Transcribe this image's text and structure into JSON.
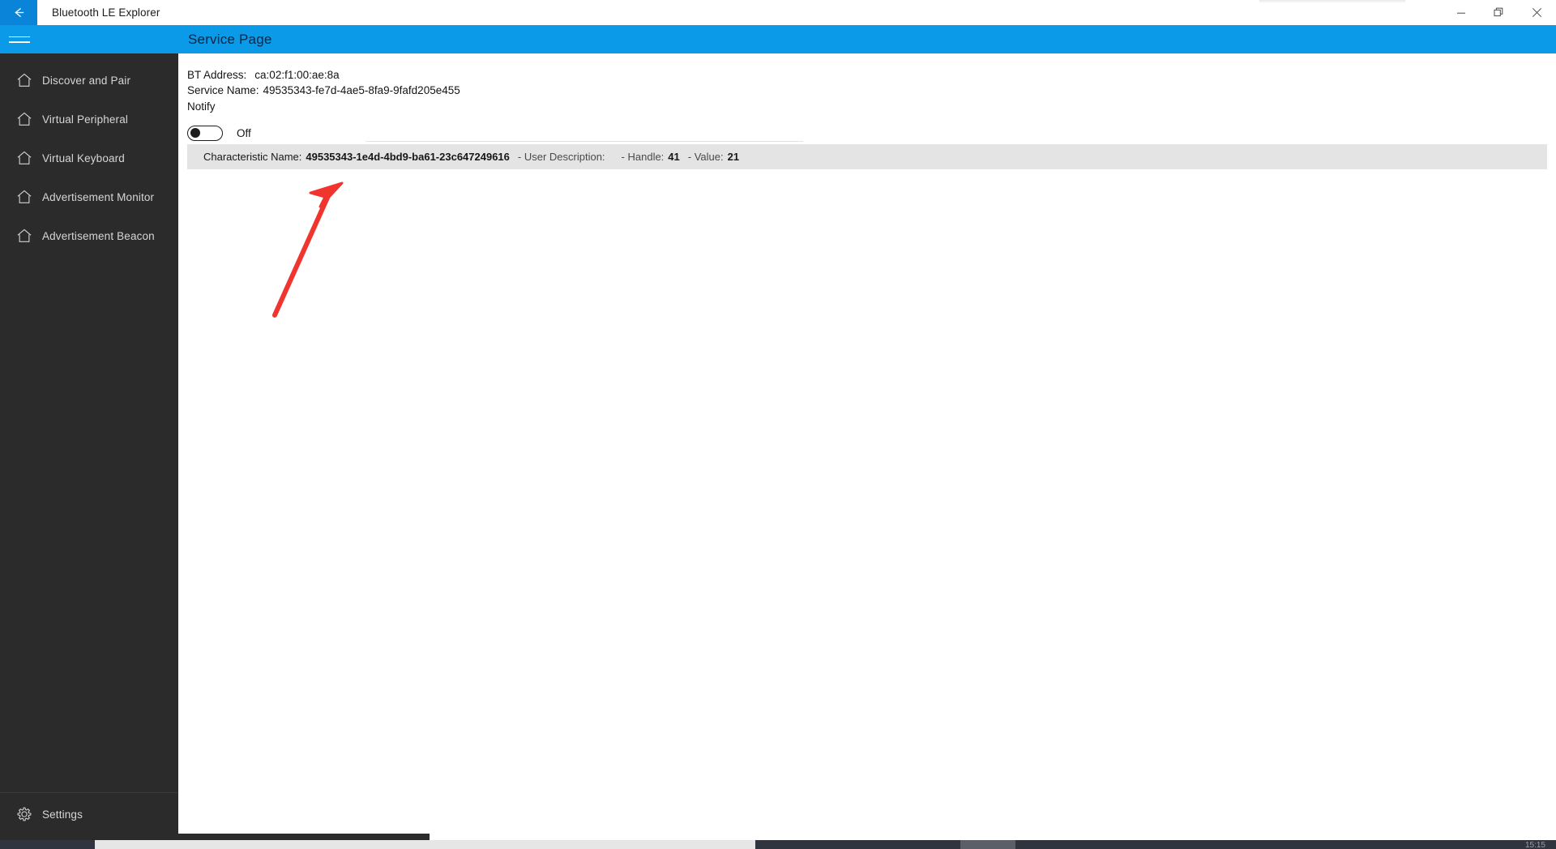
{
  "window": {
    "title": "Bluetooth LE Explorer",
    "back_icon": "back-arrow-icon",
    "minimize_label": "—",
    "maximize_label": "❐",
    "close_label": "✕"
  },
  "header": {
    "page_title": "Service Page",
    "menu_icon": "hamburger-menu-icon",
    "accent_color": "#0a9ae8"
  },
  "sidebar": {
    "background_color": "#2b2b2b",
    "items": [
      {
        "label": "Discover and Pair",
        "icon": "home-icon"
      },
      {
        "label": "Virtual Peripheral",
        "icon": "home-icon"
      },
      {
        "label": "Virtual Keyboard",
        "icon": "home-icon"
      },
      {
        "label": "Advertisement Monitor",
        "icon": "home-icon"
      },
      {
        "label": "Advertisement Beacon",
        "icon": "home-icon"
      }
    ],
    "footer": {
      "label": "Settings",
      "icon": "gear-icon"
    }
  },
  "content": {
    "bt_address_label": "BT Address:",
    "bt_address_value": "ca:02:f1:00:ae:8a",
    "service_name_label": "Service Name:",
    "service_name_value": "49535343-fe7d-4ae5-8fa9-9fafd205e455",
    "notify_label": "Notify",
    "notify_toggle_state": "Off",
    "notify_toggle_on": false,
    "characteristic": {
      "name_label": "Characteristic Name:",
      "name_value": "49535343-1e4d-4bd9-ba61-23c647249616",
      "user_description_label": "- User Description:",
      "user_description_value": "",
      "handle_label": "- Handle:",
      "handle_value": "41",
      "value_label": "- Value:",
      "value_value": "21",
      "row_background": "#e4e4e4"
    }
  },
  "annotation": {
    "arrow_color": "#f0352f",
    "arrow_name": "red-arrow-pointing-to-characteristic-row"
  },
  "taskbar": {
    "clock": "15:15"
  }
}
